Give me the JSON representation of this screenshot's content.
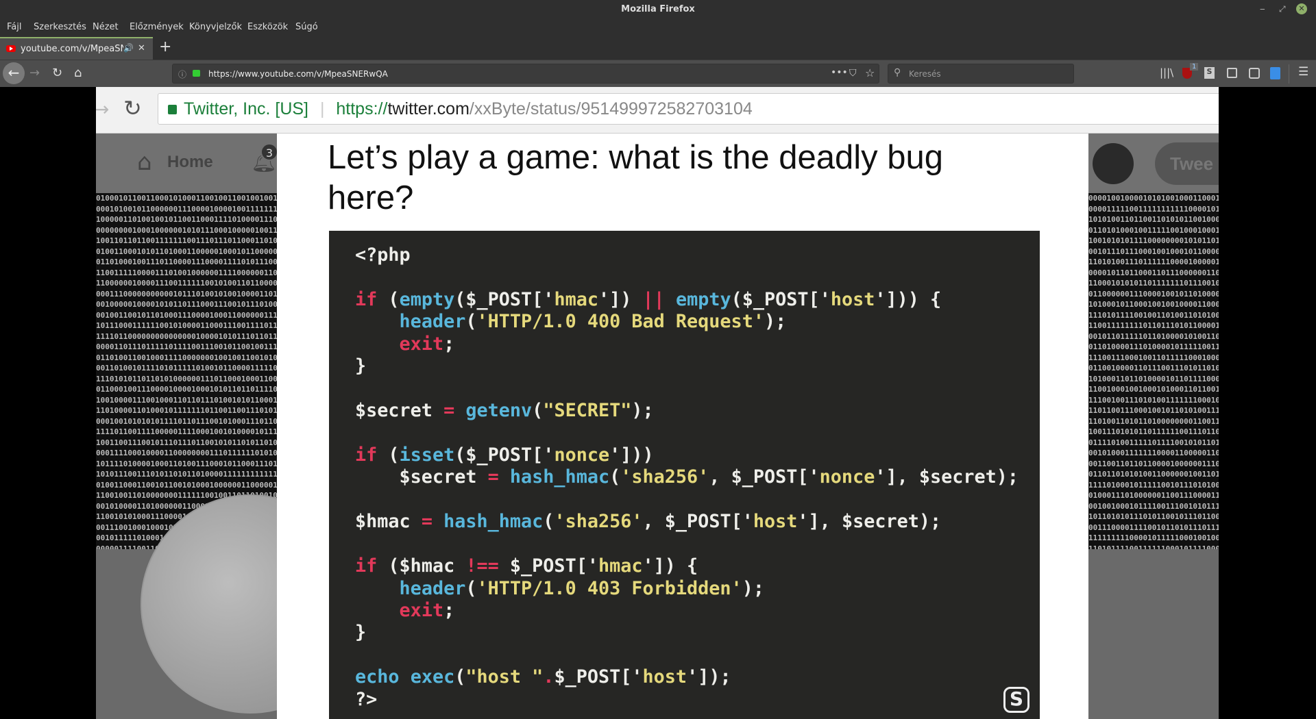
{
  "window": {
    "title": "Mozilla Firefox",
    "minimize": "‒",
    "maximize": "⤢",
    "close": "✕"
  },
  "menu": [
    "Fájl",
    "Szerkesztés",
    "Nézet",
    "Előzmények",
    "Könyvjelzők",
    "Eszközök",
    "Súgó"
  ],
  "tab": {
    "label": "youtube.com/v/MpeaSNERwQA",
    "audio": "🔊",
    "close": "✕",
    "new": "+"
  },
  "nav": {
    "url": "https://www.youtube.com/v/MpeaSNERwQA",
    "search_placeholder": "Keresés",
    "ublock_badge": "1"
  },
  "video": {
    "browser_url": {
      "org": "Twitter, Inc. [US]",
      "scheme": "https://",
      "host": "twitter.com",
      "path": "/xxByte/status/951499972582703104"
    },
    "twitter": {
      "home": "Home",
      "notif_count": "3",
      "tweet_button": "Twee"
    },
    "slide": {
      "title": "Let’s play a game: what is the deadly bug here?",
      "logo": "S"
    },
    "code": [
      [
        [
          "<?php",
          "txt"
        ]
      ],
      [],
      [
        [
          "if",
          "kw"
        ],
        [
          " (",
          "txt"
        ],
        [
          "empty",
          "fn"
        ],
        [
          "($_POST['",
          "txt"
        ],
        [
          "hmac",
          "str"
        ],
        [
          "']) ",
          "txt"
        ],
        [
          "||",
          "op"
        ],
        [
          " ",
          "txt"
        ],
        [
          "empty",
          "fn"
        ],
        [
          "($_POST['",
          "txt"
        ],
        [
          "host",
          "str"
        ],
        [
          "'])) {",
          "txt"
        ]
      ],
      [
        [
          "    ",
          "txt"
        ],
        [
          "header",
          "fn"
        ],
        [
          "(",
          "txt"
        ],
        [
          "'HTTP/1.0 400 Bad Request'",
          "str"
        ],
        [
          ");",
          "txt"
        ]
      ],
      [
        [
          "    ",
          "txt"
        ],
        [
          "exit",
          "kw"
        ],
        [
          ";",
          "txt"
        ]
      ],
      [
        [
          "}",
          "txt"
        ]
      ],
      [],
      [
        [
          "$secret ",
          "txt"
        ],
        [
          "=",
          "op"
        ],
        [
          " ",
          "txt"
        ],
        [
          "getenv",
          "fn"
        ],
        [
          "(",
          "txt"
        ],
        [
          "\"SECRET\"",
          "str"
        ],
        [
          ");",
          "txt"
        ]
      ],
      [],
      [
        [
          "if",
          "kw"
        ],
        [
          " (",
          "txt"
        ],
        [
          "isset",
          "fn"
        ],
        [
          "($_POST['",
          "txt"
        ],
        [
          "nonce",
          "str"
        ],
        [
          "']))",
          "txt"
        ]
      ],
      [
        [
          "    $secret ",
          "txt"
        ],
        [
          "=",
          "op"
        ],
        [
          " ",
          "txt"
        ],
        [
          "hash_hmac",
          "fn"
        ],
        [
          "(",
          "txt"
        ],
        [
          "'sha256'",
          "str"
        ],
        [
          ", $_POST['",
          "txt"
        ],
        [
          "nonce",
          "str"
        ],
        [
          "'], $secret);",
          "txt"
        ]
      ],
      [],
      [
        [
          "$hmac ",
          "txt"
        ],
        [
          "=",
          "op"
        ],
        [
          " ",
          "txt"
        ],
        [
          "hash_hmac",
          "fn"
        ],
        [
          "(",
          "txt"
        ],
        [
          "'sha256'",
          "str"
        ],
        [
          ", $_POST['",
          "txt"
        ],
        [
          "host",
          "str"
        ],
        [
          "'], $secret);",
          "txt"
        ]
      ],
      [],
      [
        [
          "if",
          "kw"
        ],
        [
          " ($hmac ",
          "txt"
        ],
        [
          "!==",
          "op"
        ],
        [
          " $_POST['",
          "txt"
        ],
        [
          "hmac",
          "str"
        ],
        [
          "']) {",
          "txt"
        ]
      ],
      [
        [
          "    ",
          "txt"
        ],
        [
          "header",
          "fn"
        ],
        [
          "(",
          "txt"
        ],
        [
          "'HTTP/1.0 403 Forbidden'",
          "str"
        ],
        [
          ");",
          "txt"
        ]
      ],
      [
        [
          "    ",
          "txt"
        ],
        [
          "exit",
          "kw"
        ],
        [
          ";",
          "txt"
        ]
      ],
      [
        [
          "}",
          "txt"
        ]
      ],
      [],
      [
        [
          "echo",
          "fn"
        ],
        [
          " ",
          "txt"
        ],
        [
          "exec",
          "fn"
        ],
        [
          "(",
          "txt"
        ],
        [
          "\"host \"",
          "str"
        ],
        [
          ".",
          "op"
        ],
        [
          "$_POST['",
          "txt"
        ],
        [
          "host",
          "str"
        ],
        [
          "']);",
          "txt"
        ]
      ],
      [
        [
          "?>",
          "txt"
        ]
      ]
    ]
  }
}
